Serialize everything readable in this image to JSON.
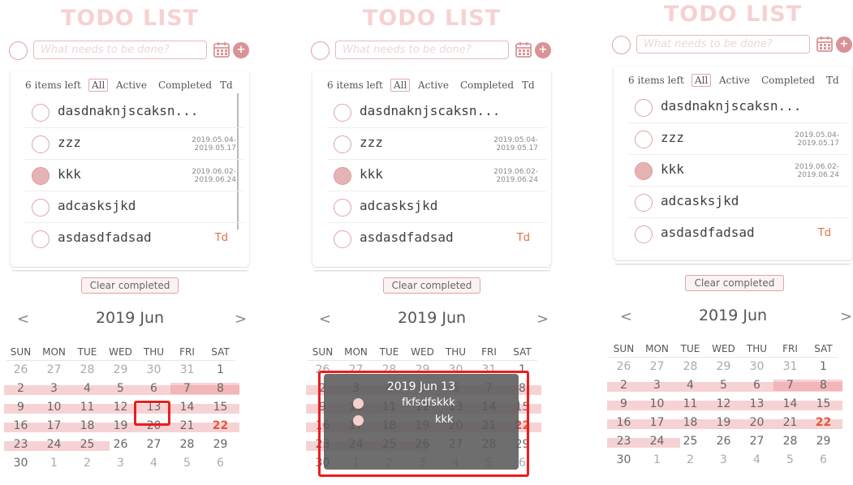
{
  "app": {
    "title": "TODO LIST",
    "input_placeholder": "What needs to be done?",
    "add_label": "+",
    "accent": "#e2a7aa",
    "done_color": "#e6b3b5"
  },
  "filters": {
    "items_left": "6 items left",
    "all": "All",
    "active": "Active",
    "completed": "Completed",
    "td": "Td"
  },
  "todos": [
    {
      "text": "dasdnaknjscaksn...",
      "done": false,
      "date_start": "",
      "date_end": "",
      "tag": ""
    },
    {
      "text": "zzz",
      "done": false,
      "date_start": "2019.05.04-",
      "date_end": "2019.05.17",
      "tag": ""
    },
    {
      "text": "kkk",
      "done": true,
      "date_start": "2019.06.02-",
      "date_end": "2019.06.24",
      "tag": ""
    },
    {
      "text": "adcasksjkd",
      "done": false,
      "date_start": "",
      "date_end": "",
      "tag": ""
    },
    {
      "text": "asdasdfadsad",
      "done": false,
      "date_start": "",
      "date_end": "",
      "tag": "Td"
    }
  ],
  "clear_completed": "Clear completed",
  "calendar": {
    "prev": "<",
    "next": ">",
    "month": "2019 Jun",
    "weekdays": [
      "SUN",
      "MON",
      "TUE",
      "WED",
      "THU",
      "FRI",
      "SAT"
    ],
    "weeks": [
      [
        "26",
        "27",
        "28",
        "29",
        "30",
        "31",
        "1"
      ],
      [
        "2",
        "3",
        "4",
        "5",
        "6",
        "7",
        "8"
      ],
      [
        "9",
        "10",
        "11",
        "12",
        "13",
        "14",
        "15"
      ],
      [
        "16",
        "17",
        "18",
        "19",
        "20",
        "21",
        "22"
      ],
      [
        "23",
        "24",
        "25",
        "26",
        "27",
        "28",
        "29"
      ],
      [
        "30",
        "1",
        "2",
        "3",
        "4",
        "5",
        "6"
      ]
    ],
    "today": "22"
  },
  "tooltip": {
    "title": "2019 Jun 13",
    "items": [
      "fkfsdfskkk",
      "kkk"
    ]
  }
}
